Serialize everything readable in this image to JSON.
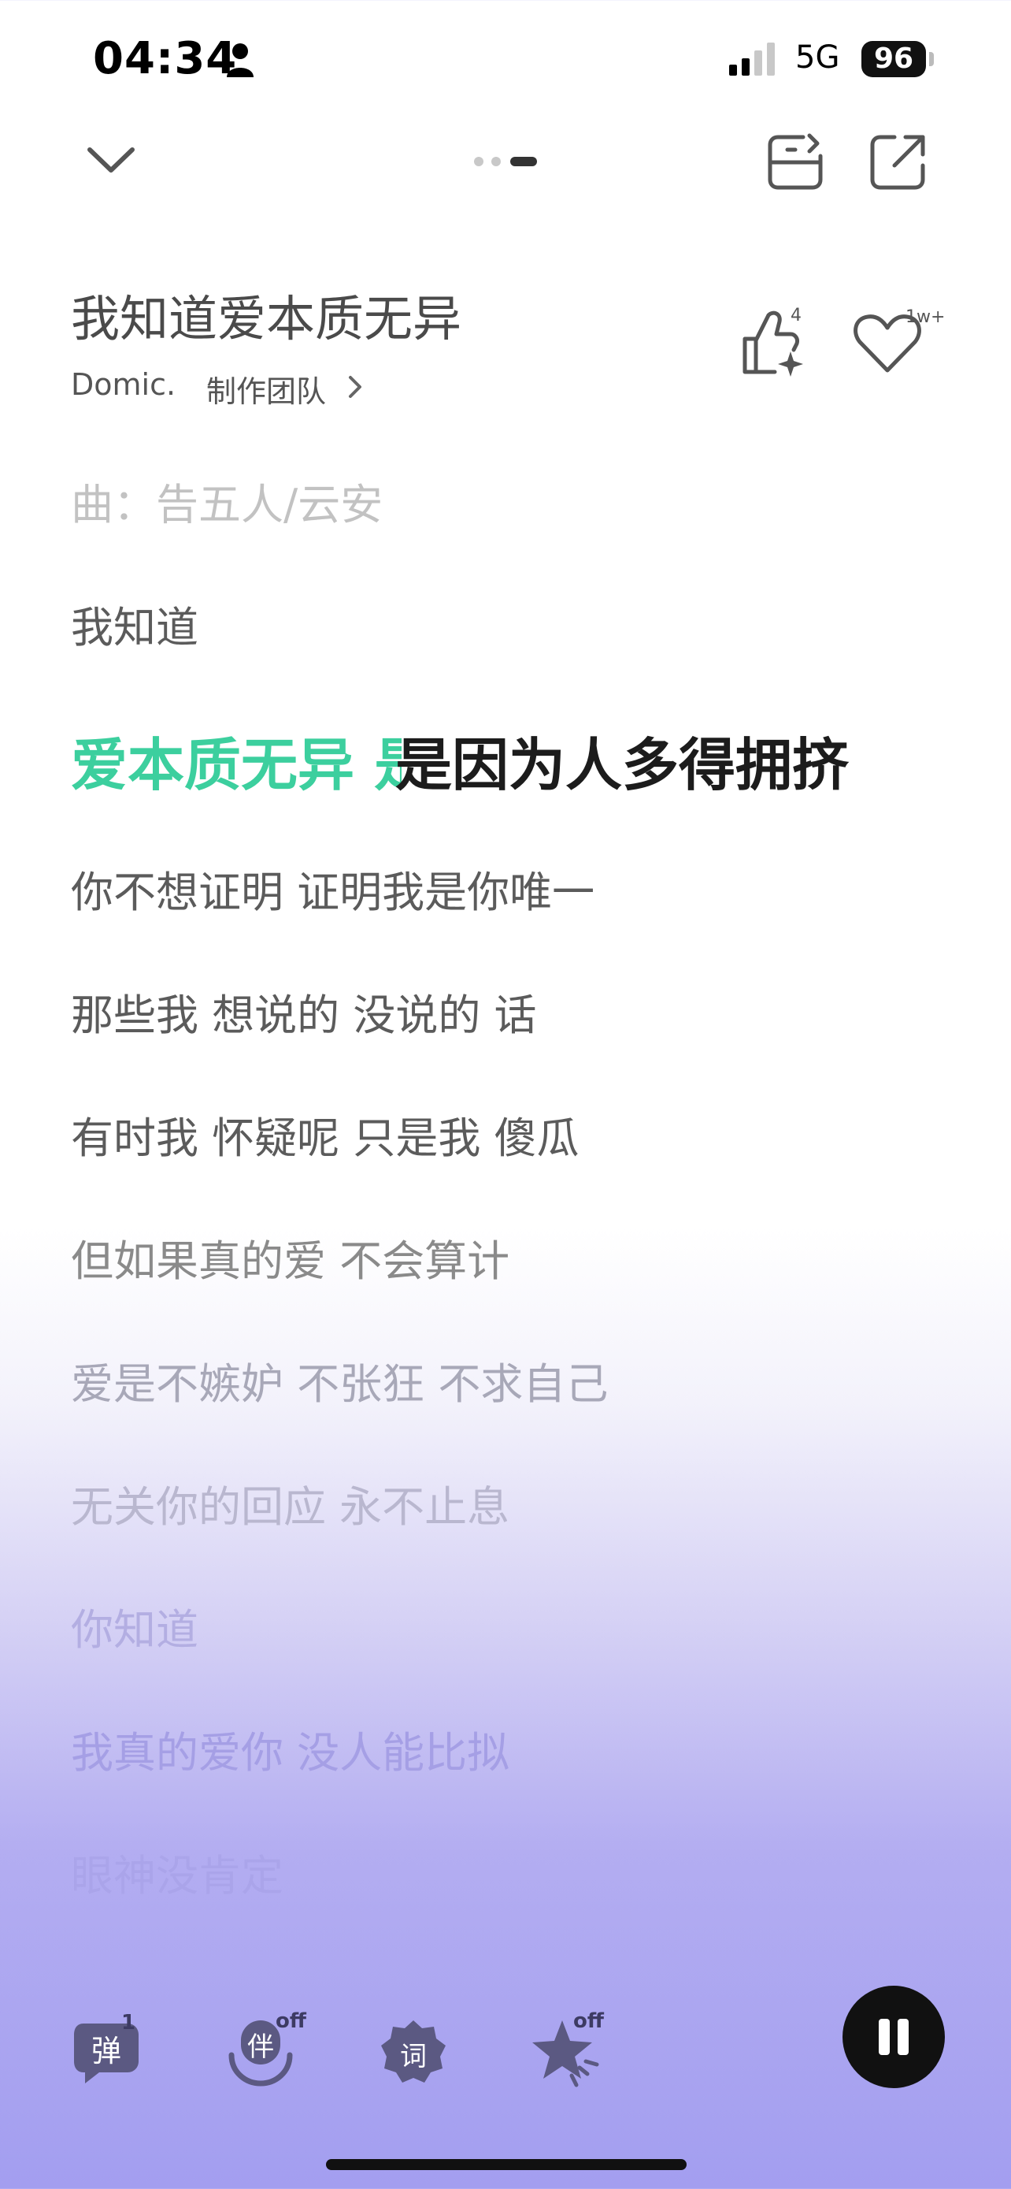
{
  "status_bar": {
    "time": "04:34",
    "network": "5G",
    "battery": "96"
  },
  "nav": {
    "collapse_icon": "chevron-down-icon",
    "save_icon": "save-icon",
    "share_icon": "share-icon"
  },
  "song": {
    "title": "我知道爱本质无异",
    "artist": "Domic.",
    "team": "制作团队",
    "like_count": "4",
    "favorite_count": "1w+"
  },
  "lyrics": {
    "credit": "曲：告五人/云安",
    "line1": "我知道",
    "current_sung": "爱本质无异 是",
    "current_rest": "是因为人多得拥挤",
    "line3": "你不想证明 证明我是你唯一",
    "line4": "那些我 想说的 没说的 话",
    "line5": "有时我 怀疑呢 只是我 傻瓜",
    "line6": "但如果真的爱 不会算计",
    "line7": "爱是不嫉妒 不张狂 不求自己",
    "line8": "无关你的回应 永不止息",
    "line9": "你知道",
    "line10": "我真的爱你 没人能比拟",
    "line11": "眼神没肯定"
  },
  "toolbar": {
    "danmaku_badge": "1",
    "danmaku_glyph": "弹",
    "accompany_glyph": "伴",
    "accompany_badge": "off",
    "lyric_glyph": "词",
    "effect_badge": "off"
  },
  "colors": {
    "sung_highlight": "#3ccf9e",
    "gradient_bottom": "#a39ef0"
  }
}
